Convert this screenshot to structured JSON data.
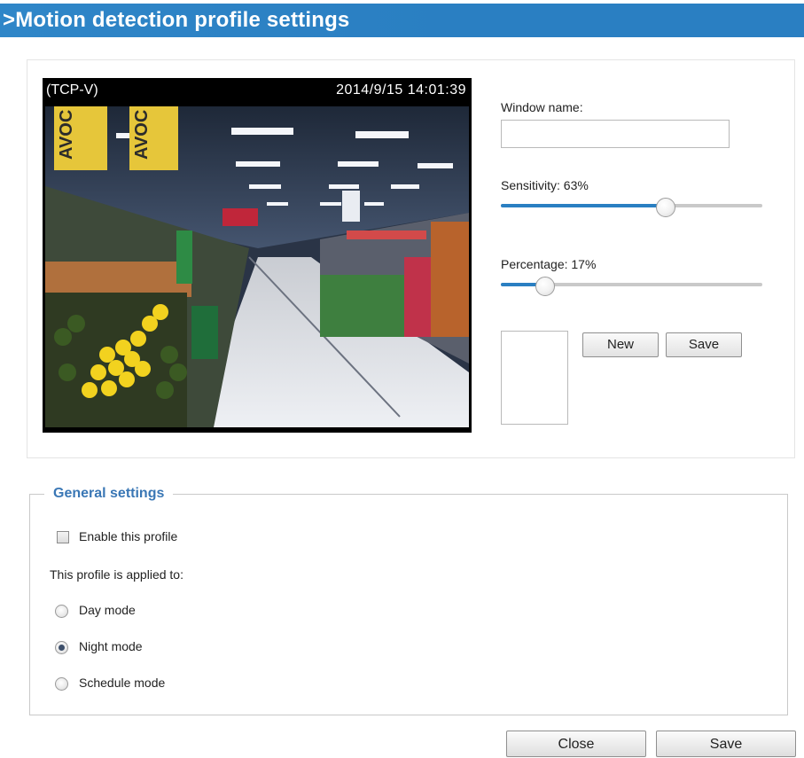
{
  "title": ">Motion detection profile settings",
  "video": {
    "stream_label": "(TCP-V)",
    "timestamp": "2014/9/15 14:01:39"
  },
  "window_name": {
    "label": "Window name:",
    "value": ""
  },
  "sensitivity": {
    "label": "Sensitivity: 63%",
    "value": 0.63
  },
  "percentage": {
    "label": "Percentage: 17%",
    "value": 0.17
  },
  "buttons": {
    "new": "New",
    "save": "Save"
  },
  "general_settings": {
    "legend": "General settings",
    "enable_label": "Enable this profile",
    "enable_checked": false,
    "applied_to_label": "This profile is applied to:",
    "modes": [
      {
        "label": "Day mode",
        "selected": false
      },
      {
        "label": "Night mode",
        "selected": true
      },
      {
        "label": "Schedule mode",
        "selected": false
      }
    ]
  },
  "footer": {
    "close": "Close",
    "save": "Save"
  },
  "colors": {
    "accent": "#2a7fc2",
    "legend": "#3a77b5"
  }
}
